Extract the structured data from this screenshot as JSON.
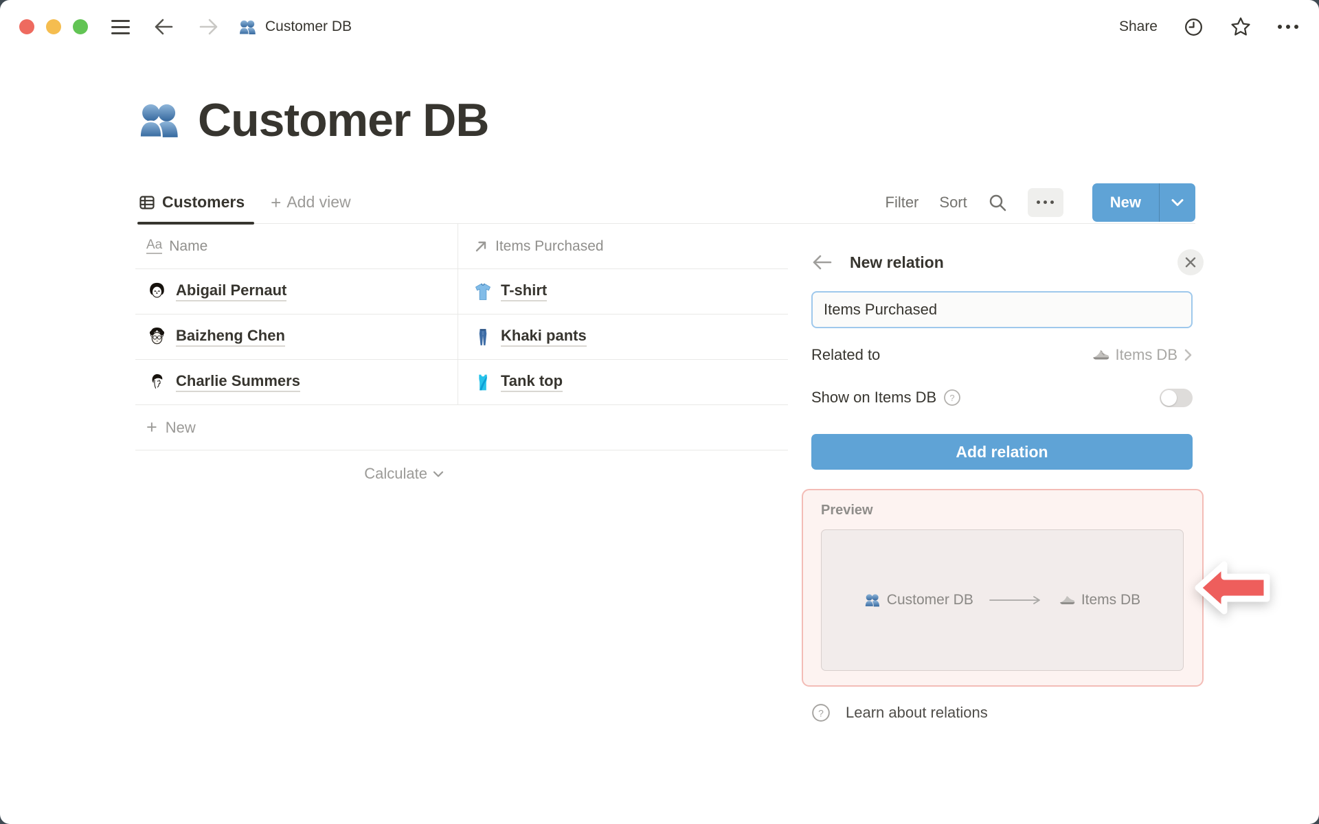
{
  "titlebar": {
    "title": "Customer DB",
    "share_label": "Share"
  },
  "page": {
    "title": "Customer DB"
  },
  "toolbar": {
    "tab_label": "Customers",
    "add_view_label": "Add view",
    "filter_label": "Filter",
    "sort_label": "Sort",
    "new_label": "New"
  },
  "table": {
    "columns": [
      {
        "label": "Name"
      },
      {
        "label": "Items Purchased"
      }
    ],
    "rows": [
      {
        "name": "Abigail Pernaut",
        "item": "T-shirt"
      },
      {
        "name": "Baizheng Chen",
        "item": "Khaki pants"
      },
      {
        "name": "Charlie Summers",
        "item": "Tank top"
      }
    ],
    "new_row_label": "New",
    "calculate_label": "Calculate"
  },
  "panel": {
    "title": "New relation",
    "name_value": "Items Purchased",
    "related_to_label": "Related to",
    "related_to_value": "Items DB",
    "show_on_label": "Show on Items DB",
    "toggle_state": "off",
    "add_button_label": "Add relation",
    "preview": {
      "label": "Preview",
      "source": "Customer DB",
      "target": "Items DB"
    },
    "learn_label": "Learn about relations"
  },
  "icons": {
    "window_icon": "people-busts",
    "page_icon": "people-busts",
    "tab_icon": "table-view",
    "name_property_icon": "text-Aa",
    "relation_property_icon": "arrow-up-right",
    "row_item_icons": [
      "t-shirt",
      "jeans",
      "tank-top"
    ],
    "related_db_icon": "running-shoe",
    "annotation": "red-arrow-left"
  },
  "colors": {
    "accent_blue": "#5fa3d6",
    "input_focus_border": "#9ec8ec",
    "preview_border_pink": "#f3bcb6",
    "preview_bg_pink": "#fdf3f1",
    "red_arrow": "#ee5e5c",
    "text_dark": "#37352f",
    "text_gray": "#9b9a97",
    "line_gray": "#e9e9e7"
  }
}
